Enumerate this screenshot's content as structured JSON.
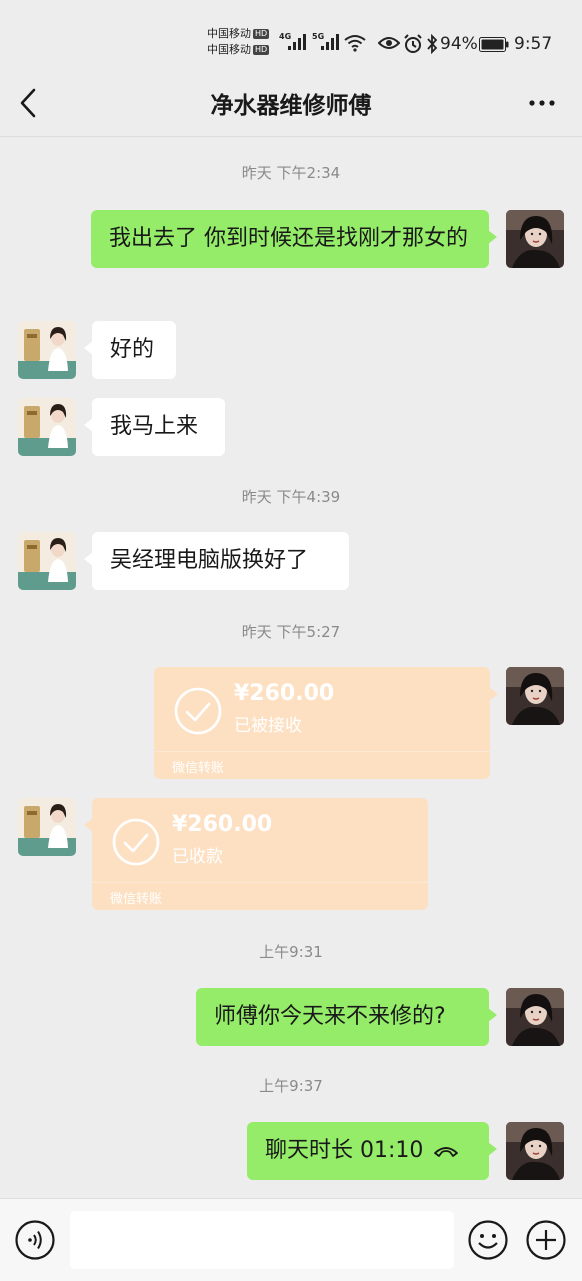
{
  "status_bar": {
    "carrier_line1": "中国移动",
    "carrier_line2": "中国移动",
    "hd_badge": "HD",
    "sim1_network": "4G",
    "sim2_network": "5G",
    "battery_percent": "94%",
    "time": "9:57",
    "icons": [
      "signal-icon",
      "wifi-icon",
      "eye-icon",
      "alarm-icon",
      "bluetooth-icon",
      "battery-icon"
    ]
  },
  "header": {
    "title": "净水器维修师傅",
    "back_icon": "back-arrow-icon",
    "more_icon": "more-dots-icon"
  },
  "messages": [
    {
      "type": "timestamp",
      "text": "昨天 下午2:34"
    },
    {
      "type": "text",
      "from": "me",
      "text": "我出去了 你到时候还是找刚才那女的"
    },
    {
      "type": "text",
      "from": "them",
      "text": "好的"
    },
    {
      "type": "text",
      "from": "them",
      "text": "我马上来"
    },
    {
      "type": "timestamp",
      "text": "昨天 下午4:39"
    },
    {
      "type": "text",
      "from": "them",
      "text": "吴经理电脑版换好了"
    },
    {
      "type": "timestamp",
      "text": "昨天 下午5:27"
    },
    {
      "type": "transfer",
      "from": "me",
      "amount": "¥260.00",
      "status": "已被接收",
      "kind": "微信转账"
    },
    {
      "type": "transfer",
      "from": "them",
      "amount": "¥260.00",
      "status": "已收款",
      "kind": "微信转账"
    },
    {
      "type": "timestamp",
      "text": "上午9:31"
    },
    {
      "type": "text",
      "from": "me",
      "text": "师傅你今天来不来修的?"
    },
    {
      "type": "timestamp",
      "text": "上午9:37"
    },
    {
      "type": "call",
      "from": "me",
      "text": "聊天时长 01:10"
    }
  ],
  "input_bar": {
    "placeholder": "",
    "voice_icon": "voice-icon",
    "emoji_icon": "emoji-icon",
    "plus_icon": "plus-icon"
  },
  "colors": {
    "background": "#ededed",
    "my_bubble": "#95ec69",
    "their_bubble": "#ffffff",
    "transfer_bubble": "#fde0c2",
    "timestamp_text": "#8a8a8a"
  }
}
